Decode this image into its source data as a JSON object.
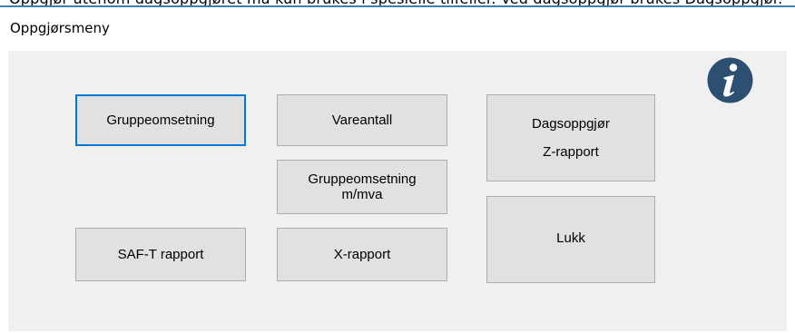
{
  "top_strip_text": "Oppgjør utenom dagsoppgjøret må kun brukes i spesielle tilfeller. Ved dagsoppgjør brukes Dagsoppgjør.",
  "window": {
    "title": "Oppgjørsmeny"
  },
  "buttons": {
    "gruppeomsetning": "Gruppeomsetning",
    "vareantall": "Vareantall",
    "dagsoppgjor_line1": "Dagsoppgjør",
    "dagsoppgjor_line2": "Z-rapport",
    "gruppeomsetning_mva_line1": "Gruppeomsetning",
    "gruppeomsetning_mva_line2": "m/mva",
    "saft": "SAF-T rapport",
    "xrapport": "X-rapport",
    "lukk": "Lukk"
  },
  "icons": {
    "info": "info-icon"
  },
  "colors": {
    "focus_border": "#0078d7",
    "info_icon": "#2d4f72",
    "panel": "#f0f0f0",
    "button": "#e1e1e1"
  }
}
